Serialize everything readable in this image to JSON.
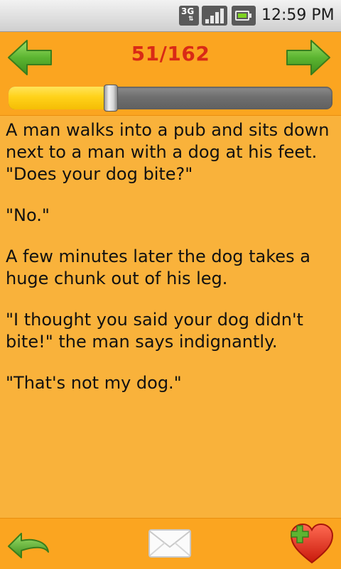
{
  "status_bar": {
    "network": "3G",
    "time": "12:59 PM",
    "icons": [
      "3g-data-icon",
      "signal-strength-icon",
      "battery-icon"
    ]
  },
  "header": {
    "prev_icon": "arrow-left-icon",
    "next_icon": "arrow-right-icon",
    "counter": "51/162",
    "progress": {
      "current": 51,
      "total": 162
    },
    "colors": {
      "counter": "#d92a16",
      "arrow": "#59b32d",
      "background": "#fba520"
    }
  },
  "joke": {
    "paragraphs": [
      "A man walks into a pub and sits down next to a man with a dog at his feet. \"Does your dog bite?\"",
      "\"No.\"",
      "A few minutes later the dog takes a huge chunk out of his leg.",
      "\"I thought you said your dog didn't bite!\" the man says indignantly.",
      "\"That's not my dog.\""
    ]
  },
  "footer": {
    "buttons": [
      {
        "name": "back",
        "icon": "undo-arrow-icon"
      },
      {
        "name": "share",
        "icon": "envelope-icon"
      },
      {
        "name": "favorite",
        "icon": "heart-plus-icon"
      }
    ]
  }
}
